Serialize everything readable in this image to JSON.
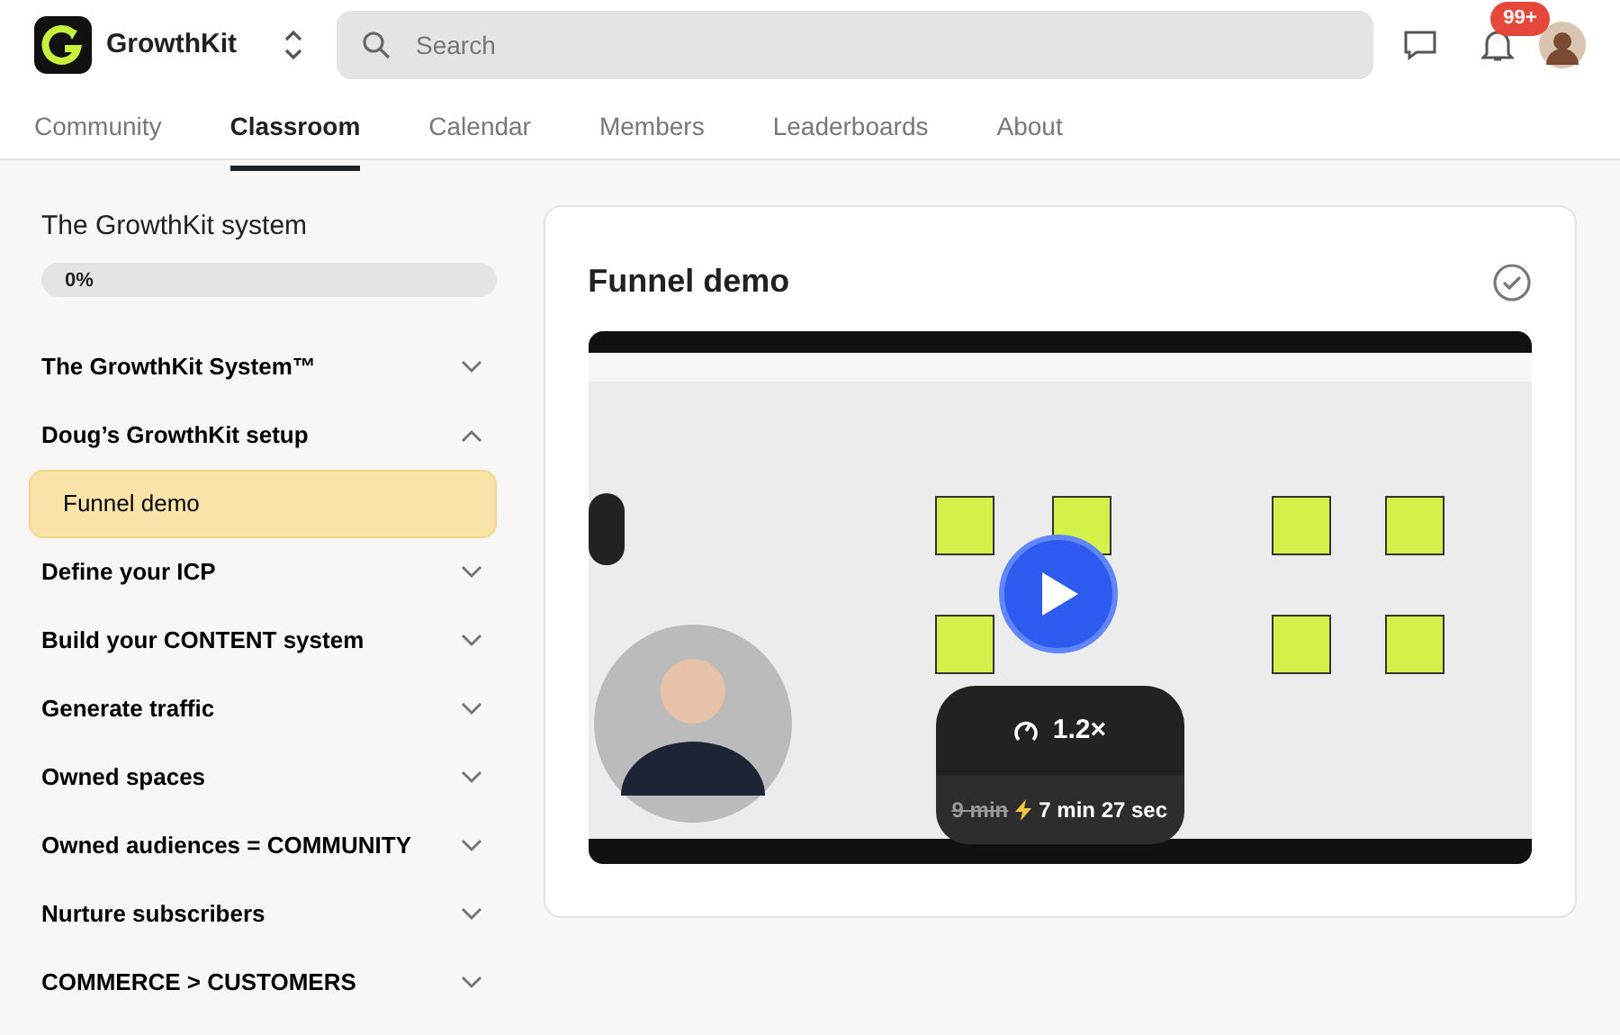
{
  "brand": {
    "name": "GrowthKit"
  },
  "search": {
    "placeholder": "Search"
  },
  "notifications": {
    "count": "99+"
  },
  "tabs": [
    {
      "label": "Community",
      "selected": false
    },
    {
      "label": "Classroom",
      "selected": true
    },
    {
      "label": "Calendar",
      "selected": false
    },
    {
      "label": "Members",
      "selected": false
    },
    {
      "label": "Leaderboards",
      "selected": false
    },
    {
      "label": "About",
      "selected": false
    }
  ],
  "course": {
    "title": "The GrowthKit system",
    "progress": {
      "level": 0,
      "reading": "0%"
    }
  },
  "modules": [
    {
      "title": "The GrowthKit System™",
      "expanded": false
    },
    {
      "title": "Doug’s GrowthKit setup",
      "expanded": true,
      "lessons": [
        {
          "title": "Funnel demo",
          "selected": true
        }
      ]
    },
    {
      "title": "Define your ICP",
      "expanded": false
    },
    {
      "title": "Build your CONTENT system",
      "expanded": false
    },
    {
      "title": "Generate traffic",
      "expanded": false
    },
    {
      "title": "Owned spaces",
      "expanded": false
    },
    {
      "title": "Owned audiences = COMMUNITY",
      "expanded": false
    },
    {
      "title": "Nurture subscribers",
      "expanded": false
    },
    {
      "title": "COMMERCE > CUSTOMERS",
      "expanded": false
    }
  ],
  "lesson": {
    "title": "Funnel demo",
    "completed": false,
    "video": {
      "speed": "1.2×",
      "original_duration": "9 min",
      "new_duration": "7 min 27 sec"
    }
  }
}
